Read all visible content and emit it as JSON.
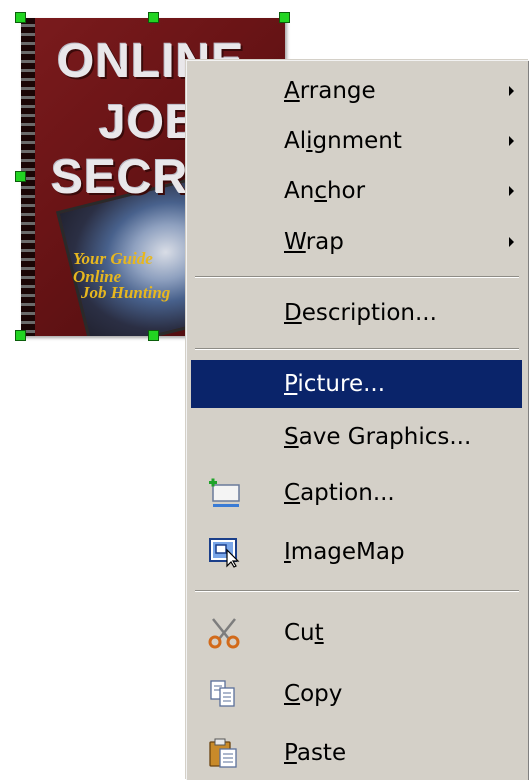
{
  "image": {
    "cover_title_lines": [
      "ONLINE",
      "JOB",
      "SECR"
    ],
    "cover_tagline_lines": [
      "Your Guide",
      "Online",
      "Job Hunting"
    ]
  },
  "menu": {
    "items": [
      {
        "pre": "",
        "ul": "A",
        "post": "rrange",
        "has_submenu": true
      },
      {
        "pre": "Al",
        "ul": "i",
        "post": "gnment",
        "has_submenu": true
      },
      {
        "pre": "An",
        "ul": "c",
        "post": "hor",
        "has_submenu": true
      },
      {
        "pre": "",
        "ul": "W",
        "post": "rap",
        "has_submenu": true
      },
      {
        "pre": "",
        "ul": "D",
        "post": "escription...",
        "has_submenu": false
      },
      {
        "pre": "",
        "ul": "P",
        "post": "icture...",
        "has_submenu": false,
        "highlighted": true
      },
      {
        "pre": "",
        "ul": "S",
        "post": "ave Graphics...",
        "has_submenu": false
      },
      {
        "pre": "",
        "ul": "C",
        "post": "aption...",
        "has_submenu": false,
        "icon": "insert-caption-icon"
      },
      {
        "pre": "",
        "ul": "I",
        "post": "mageMap",
        "has_submenu": false,
        "icon": "imagemap-icon"
      },
      {
        "pre": "Cu",
        "ul": "t",
        "post": "",
        "has_submenu": false,
        "icon": "scissors-icon"
      },
      {
        "pre": "",
        "ul": "C",
        "post": "opy",
        "has_submenu": false,
        "icon": "copy-icon"
      },
      {
        "pre": "",
        "ul": "P",
        "post": "aste",
        "has_submenu": false,
        "icon": "paste-icon"
      }
    ],
    "highlight_color": "#0a246a",
    "background_color": "#d4d0c8"
  },
  "selection_handle_color": "#22d422"
}
